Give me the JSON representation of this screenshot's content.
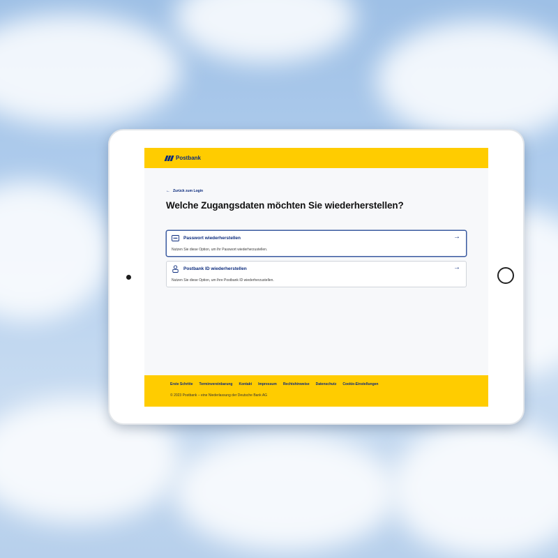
{
  "brand": {
    "name": "Postbank",
    "header_color": "#ffcc00",
    "primary_color": "#0a2a7c"
  },
  "back_link": {
    "icon": "arrow-left-icon",
    "label": "Zurück zum Login"
  },
  "page": {
    "title": "Welche Zugangsdaten möchten Sie wiederherstellen?"
  },
  "options": [
    {
      "icon": "password-icon",
      "title": "Passwort wiederherstellen",
      "description": "Nutzen Sie diese Option, um Ihr Passwort wiederherzustellen.",
      "arrow": "→",
      "selected": true
    },
    {
      "icon": "user-id-icon",
      "title": "Postbank ID wiederherstellen",
      "description": "Nutzen Sie diese Option, um Ihre Postbank ID wiederherzustellen.",
      "arrow": "→",
      "selected": false
    }
  ],
  "footer": {
    "links": [
      "Erste Schritte",
      "Terminvereinbarung",
      "Kontakt",
      "Impressum",
      "Rechtshinweise",
      "Datenschutz",
      "Cookie-Einstellungen"
    ],
    "copyright": "© 2023 Postbank – eine Niederlassung der Deutsche Bank AG"
  }
}
